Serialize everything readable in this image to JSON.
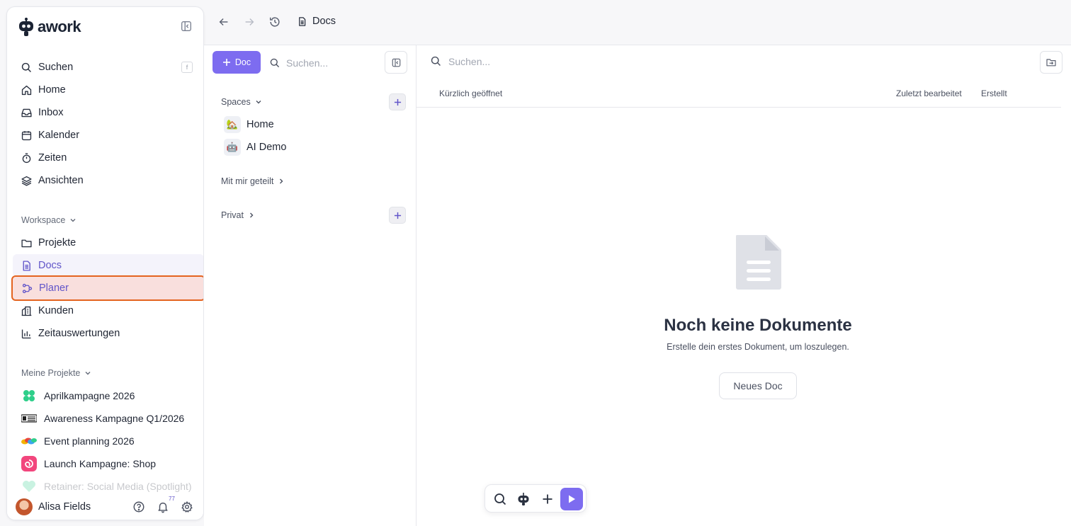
{
  "app": {
    "brand": "awork",
    "accent": "#7d6cf0"
  },
  "sidebar": {
    "search": {
      "label": "Suchen",
      "shortcut": "f"
    },
    "nav": [
      {
        "label": "Home",
        "icon": "home-icon"
      },
      {
        "label": "Inbox",
        "icon": "inbox-icon"
      },
      {
        "label": "Kalender",
        "icon": "calendar-icon"
      },
      {
        "label": "Zeiten",
        "icon": "stopwatch-icon"
      },
      {
        "label": "Ansichten",
        "icon": "layers-icon"
      }
    ],
    "workspace": {
      "title": "Workspace",
      "items": [
        {
          "label": "Projekte",
          "icon": "folder-icon"
        },
        {
          "label": "Docs",
          "icon": "document-icon",
          "active": true
        },
        {
          "label": "Planer",
          "icon": "planner-icon",
          "highlighted": true
        },
        {
          "label": "Kunden",
          "icon": "building-icon"
        },
        {
          "label": "Zeitauswertungen",
          "icon": "bar-chart-icon"
        }
      ]
    },
    "my_projects": {
      "title": "Meine Projekte",
      "items": [
        {
          "label": "Aprilkampagne 2026"
        },
        {
          "label": "Awareness Kampagne Q1/2026"
        },
        {
          "label": "Event planning 2026"
        },
        {
          "label": "Launch Kampagne: Shop"
        },
        {
          "label": "Retainer: Social Media (Spotlight)"
        }
      ]
    },
    "user": {
      "name": "Alisa Fields",
      "notifications": "77"
    }
  },
  "topbar": {
    "breadcrumb": "Docs"
  },
  "docs_panel": {
    "new_button": "Doc",
    "search_placeholder": "Suchen...",
    "spaces_title": "Spaces",
    "spaces": [
      {
        "label": "Home",
        "emoji": "🏡"
      },
      {
        "label": "AI Demo",
        "emoji": "🤖"
      }
    ],
    "shared_title": "Mit mir geteilt",
    "private_title": "Privat"
  },
  "main": {
    "search_placeholder": "Suchen...",
    "columns": {
      "recent": "Kürzlich geöffnet",
      "edited": "Zuletzt bearbeitet",
      "created": "Erstellt"
    },
    "empty": {
      "title": "Noch keine Dokumente",
      "subtitle": "Erstelle dein erstes Dokument, um loszulegen.",
      "button": "Neues Doc"
    }
  }
}
